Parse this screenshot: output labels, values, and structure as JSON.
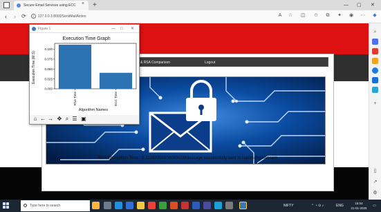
{
  "browser": {
    "tab_title": "Secure Email Services using ECC",
    "tab_close": "×",
    "new_tab": "+",
    "url": "127.0.0.1:8000/SendMailAction",
    "win_minimize": "—",
    "win_restore": "▢",
    "win_close": "✕",
    "back": "‹",
    "forward": "›",
    "reload": "⟳",
    "site_info": "i"
  },
  "site": {
    "menu": [
      "ECC & RSA Comparison",
      "Logout"
    ],
    "result_text": "RSA Encryption Time : 0.11162000000003026Message successfully sent to rajesh@gmail.com"
  },
  "figure": {
    "window_title": "Figure 1",
    "ctl_min": "—",
    "ctl_max": "□",
    "ctl_close": "✕",
    "toolbar_icons": [
      "home-icon",
      "back-icon",
      "forward-icon",
      "pan-icon",
      "zoom-icon",
      "configure-icon",
      "save-icon"
    ]
  },
  "chart_data": {
    "type": "bar",
    "title": "Execution Time Graph",
    "xlabel": "Algorithm Names",
    "ylabel": "Execution Time (M.S)",
    "categories": [
      "RSA Time",
      "ECC Time"
    ],
    "values": [
      0.1116,
      0.0405
    ],
    "ylim": [
      0,
      0.115
    ],
    "yticks": [
      "0.000",
      "0.025",
      "0.050",
      "0.075",
      "0.100"
    ],
    "bar_color": "#2d73b3",
    "grid": false
  },
  "taskbar": {
    "search_placeholder": "Type here to search",
    "ticker": "NIFTY",
    "language": "ENG",
    "time": "16:04",
    "date": "21-01-2025"
  },
  "colors": {
    "header_red": "#dd1111",
    "menubar": "#3a3a3a",
    "footer": "#050505",
    "hero_blue": "#0a3f86"
  }
}
